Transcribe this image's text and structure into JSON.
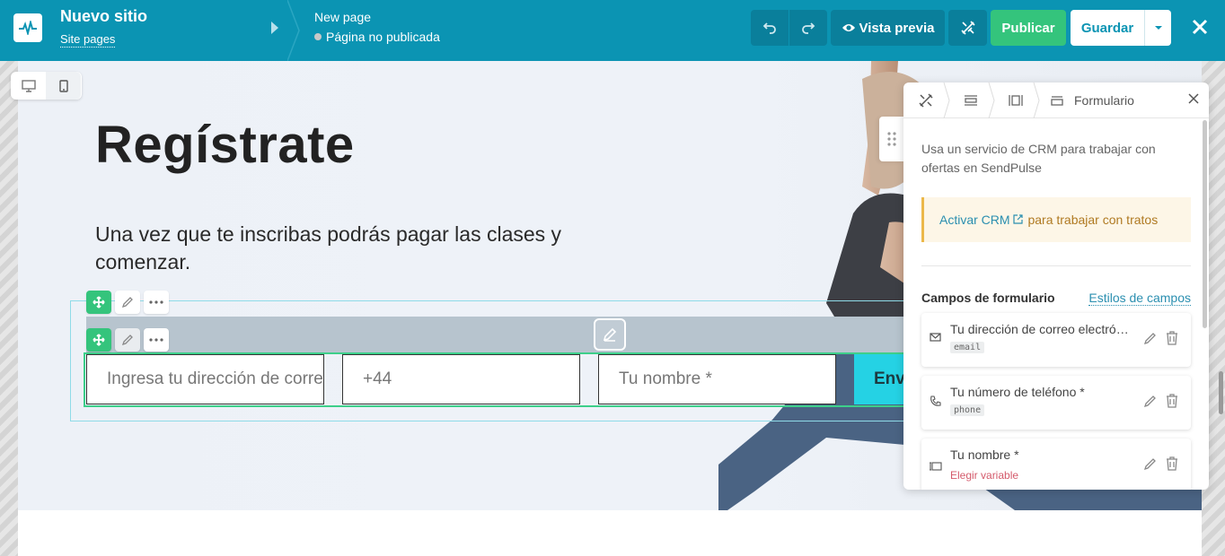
{
  "app": {
    "site_name": "Nuevo sitio",
    "site_pages": "Site pages",
    "page_name": "New page",
    "page_status": "Página no publicada"
  },
  "toolbar": {
    "preview": "Vista previa",
    "publish": "Publicar",
    "save": "Guardar"
  },
  "hero": {
    "title": "Regístrate",
    "subtitle": "Una vez que te inscribas podrás pagar las clases y comenzar."
  },
  "form": {
    "email_placeholder": "Ingresa tu dirección de correo electrónico",
    "phone_value": "+44",
    "name_placeholder": "Tu nombre *",
    "submit_label": "Enviar"
  },
  "panel": {
    "tab_label": "Formulario",
    "description": "Usa un servicio de CRM para trabajar con ofertas en SendPulse",
    "crm_link": "Activar CRM",
    "crm_suffix": "para trabajar con tratos",
    "section_title": "Campos de formulario",
    "styles_link": "Estilos de campos",
    "fields": [
      {
        "title": "Tu dirección de correo electrónico *",
        "tag": "email",
        "icon": "envelope-icon"
      },
      {
        "title": "Tu número de teléfono *",
        "tag": "phone",
        "icon": "phone-icon"
      },
      {
        "title": "Tu nombre *",
        "variable": "Elegir variable",
        "icon": "text-field-icon"
      }
    ]
  },
  "colors": {
    "topbar": "#0b94b3",
    "publish": "#34c47c",
    "submit": "#25d2e4",
    "selection": "#3dcf8a"
  }
}
